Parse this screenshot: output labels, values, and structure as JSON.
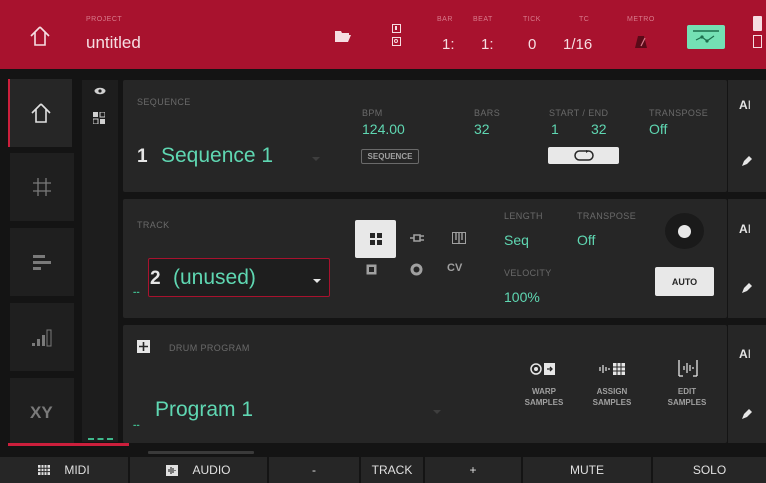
{
  "header": {
    "project_label": "PROJECT",
    "project_name": "untitled",
    "bar_label": "BAR",
    "bar_value": "1:",
    "beat_label": "BEAT",
    "beat_value": "1:",
    "tick_label": "TICK",
    "tick_value": "0",
    "tc_label": "TC",
    "tc_value": "1/16",
    "metro_label": "METRO"
  },
  "sequence": {
    "label": "SEQUENCE",
    "number": "1",
    "name": "Sequence 1",
    "bpm_label": "BPM",
    "bpm": "124.00",
    "sequence_button": "SEQUENCE",
    "bars_label": "BARS",
    "bars": "32",
    "start_end_label": "START / END",
    "start": "1",
    "end": "32",
    "transpose_label": "TRANSPOSE",
    "transpose": "Off"
  },
  "track": {
    "label": "TRACK",
    "number": "2",
    "name": "(unused)",
    "dashes": "--",
    "cv_label": "CV",
    "length_label": "LENGTH",
    "length": "Seq",
    "transpose_label": "TRANSPOSE",
    "transpose": "Off",
    "velocity_label": "VELOCITY",
    "velocity": "100%",
    "auto_button": "AUTO"
  },
  "program": {
    "label": "DRUM PROGRAM",
    "name": "Program 1",
    "dashes": "--",
    "warp_label": "WARP SAMPLES",
    "assign_label": "ASSIGN SAMPLES",
    "edit_label": "EDIT SAMPLES"
  },
  "bottom": {
    "midi": "MIDI",
    "audio": "AUDIO",
    "minus": "-",
    "track": "TRACK",
    "plus": "+",
    "mute": "MUTE",
    "solo": "SOLO"
  },
  "colors": {
    "header_red": "#a8122e",
    "accent_green": "#5fd7b2",
    "panel": "#262626"
  }
}
